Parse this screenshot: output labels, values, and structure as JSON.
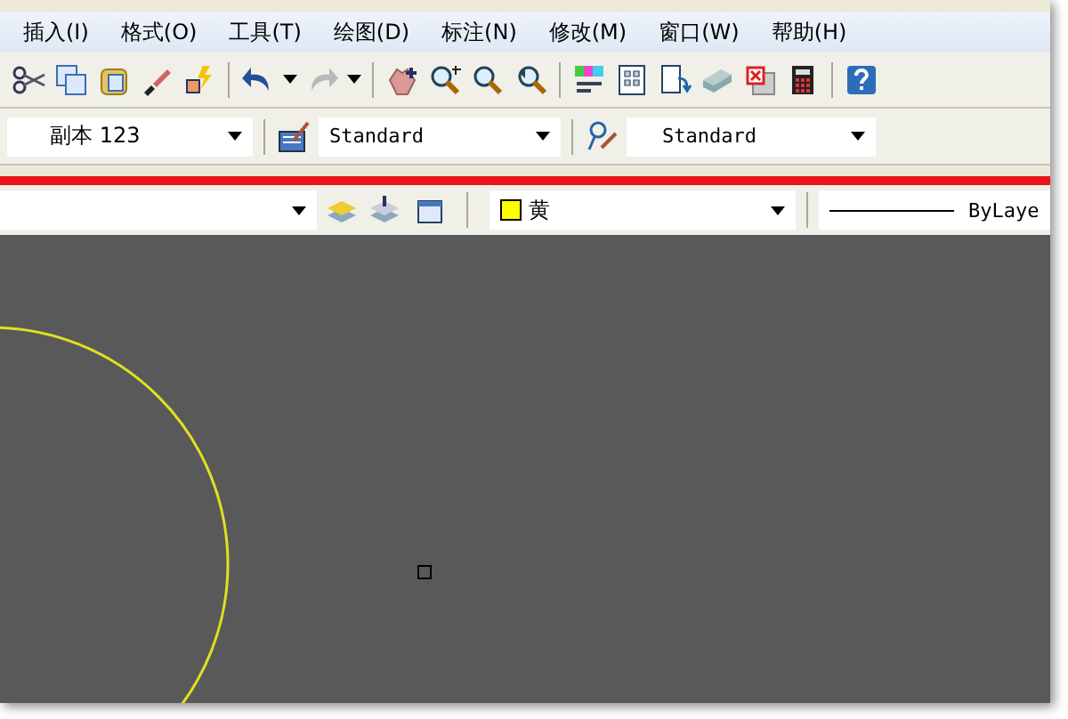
{
  "menu": [
    "插入(I)",
    "格式(O)",
    "工具(T)",
    "绘图(D)",
    "标注(N)",
    "修改(M)",
    "窗口(W)",
    "帮助(H)"
  ],
  "style_toolbar": {
    "text_style": "副本 123",
    "dim_style": "Standard",
    "multileader_style": "Standard"
  },
  "layers_toolbar": {
    "color_name": "黄",
    "color": "#ffff00",
    "linetype": "ByLaye"
  }
}
